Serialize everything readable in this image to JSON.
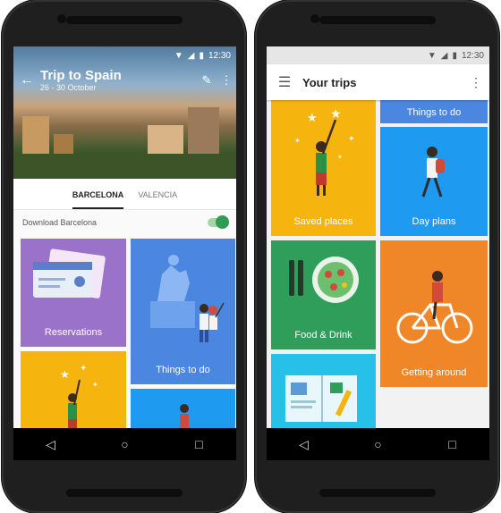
{
  "left_phone": {
    "status": {
      "time": "12:30"
    },
    "header": {
      "title": "Trip to Spain",
      "subtitle": "26 - 30 October"
    },
    "tabs": [
      {
        "label": "BARCELONA",
        "active": true
      },
      {
        "label": "VALENCIA",
        "active": false
      }
    ],
    "download": {
      "label": "Download Barcelona",
      "enabled": true
    },
    "tiles": [
      {
        "label": "Reservations",
        "color": "#9b72c9"
      },
      {
        "label": "Things to do",
        "color": "#4b86e0"
      },
      {
        "label": "",
        "color": "#f6b40e"
      },
      {
        "label": "",
        "color": "#1e9bf0"
      }
    ]
  },
  "right_phone": {
    "status": {
      "time": "12:30"
    },
    "appbar": {
      "title": "Your trips"
    },
    "tiles": [
      {
        "label": "Things to do",
        "color": "#4b86e0"
      },
      {
        "label": "Saved places",
        "color": "#f6b40e"
      },
      {
        "label": "Day plans",
        "color": "#1e9bf0"
      },
      {
        "label": "Food & Drink",
        "color": "#2f9e5b"
      },
      {
        "label": "Getting around",
        "color": "#ef8628"
      },
      {
        "label": "",
        "color": "#26c0e8"
      }
    ]
  }
}
